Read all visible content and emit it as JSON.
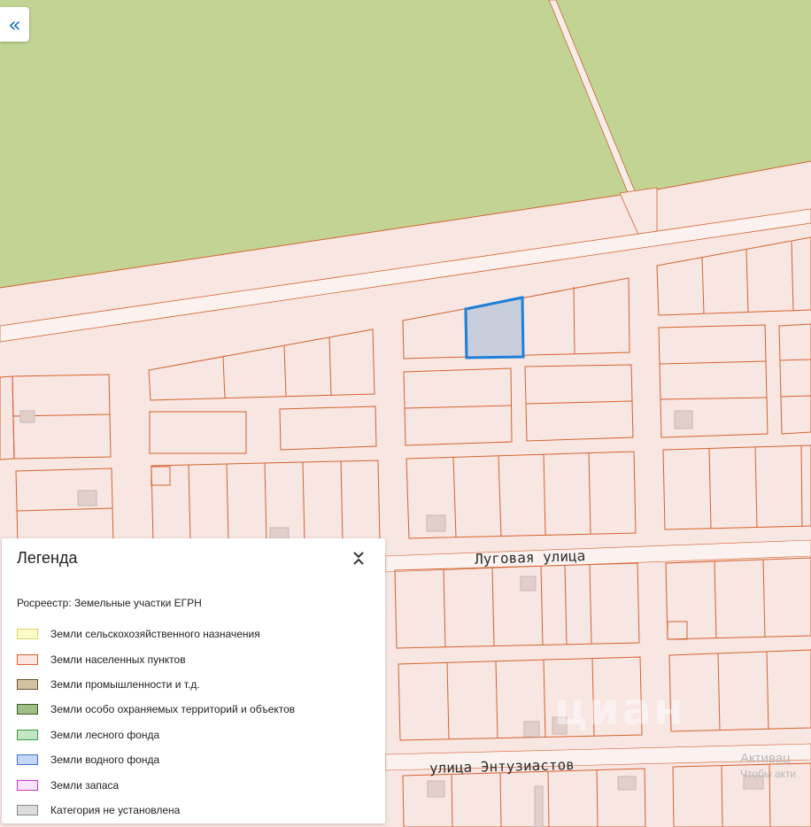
{
  "map": {
    "streets": [
      {
        "name": "Луговая улица"
      },
      {
        "name": "улица Энтузиастов"
      }
    ],
    "selected_parcel": {
      "fill": "#c8cedb",
      "stroke": "#1e7fd8"
    },
    "colors": {
      "forest": "#c2d494",
      "settlement": "#f8e6e3",
      "parcel_line": "#d4622e",
      "road": "#fbf2ef",
      "building": "#e2cfcc"
    }
  },
  "collapse_button": {
    "icon": "double-chevron-left-icon",
    "glyph": "«"
  },
  "legend": {
    "title": "Легенда",
    "toggle_icon": "chevron-collapse-icon",
    "source": "Росреестр: Земельные участки ЕГРН",
    "items": [
      {
        "label": "Земли сельскохозяйственного назначения",
        "fill": "#fdfcc8",
        "stroke": "#d9d46a"
      },
      {
        "label": "Земли населенных пунктов",
        "fill": "#fbe3df",
        "stroke": "#d4622e"
      },
      {
        "label": "Земли промышленности и т.д.",
        "fill": "#d2c2a2",
        "stroke": "#6b5333"
      },
      {
        "label": "Земли особо охраняемых территорий и объектов",
        "fill": "#9ebd87",
        "stroke": "#3b5a2b"
      },
      {
        "label": "Земли лесного фонда",
        "fill": "#c4e6c4",
        "stroke": "#3a9a46"
      },
      {
        "label": "Земли водного фонда",
        "fill": "#c4d8f6",
        "stroke": "#3a72d0"
      },
      {
        "label": "Земли запаса",
        "fill": "#fbe3fb",
        "stroke": "#c23ac2"
      },
      {
        "label": "Категория не установлена",
        "fill": "#dcdcdc",
        "stroke": "#8a8a8a"
      }
    ]
  },
  "watermark": {
    "line1": "Активац",
    "line2": "Чтобы акти",
    "logo": "циан"
  }
}
